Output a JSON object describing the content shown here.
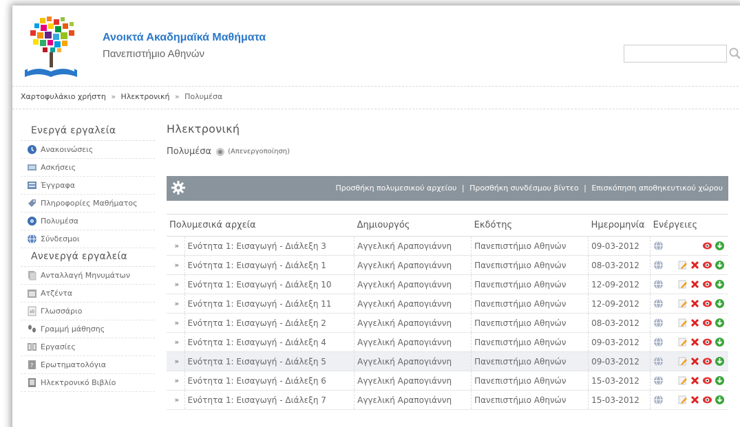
{
  "header": {
    "title": "Ανοικτά Ακαδημαϊκά Μαθήματα",
    "subtitle": "Πανεπιστήμιο Αθηνών",
    "search_value": ""
  },
  "breadcrumb": {
    "items": [
      "Χαρτοφυλάκιο χρήστη",
      "Ηλεκτρονική",
      "Πολυμέσα"
    ],
    "separator": "»"
  },
  "sidebar": {
    "active_heading": "Ενεργά εργαλεία",
    "active_items": [
      {
        "label": "Ανακοινώσεις",
        "icon": "announcements-icon"
      },
      {
        "label": "Ασκήσεις",
        "icon": "exercises-icon"
      },
      {
        "label": "Έγγραφα",
        "icon": "documents-icon"
      },
      {
        "label": "Πληροφορίες Μαθήματος",
        "icon": "course-info-icon"
      },
      {
        "label": "Πολυμέσα",
        "icon": "multimedia-icon"
      },
      {
        "label": "Σύνδεσμοι",
        "icon": "links-icon"
      }
    ],
    "inactive_heading": "Ανενεργά εργαλεία",
    "inactive_items": [
      {
        "label": "Ανταλλαγή Μηνυμάτων",
        "icon": "messages-icon"
      },
      {
        "label": "Ατζέντα",
        "icon": "agenda-icon"
      },
      {
        "label": "Γλωσσάριο",
        "icon": "glossary-icon"
      },
      {
        "label": "Γραμμή μάθησης",
        "icon": "learning-path-icon"
      },
      {
        "label": "Εργασίες",
        "icon": "assignments-icon"
      },
      {
        "label": "Ερωτηματολόγια",
        "icon": "questionnaires-icon"
      },
      {
        "label": "Ηλεκτρονικό Βιβλίο",
        "icon": "ebook-icon"
      }
    ]
  },
  "main": {
    "course_title": "Ηλεκτρονική",
    "tool_name": "Πολυμέσα",
    "toggle_label": "(Απενεργοποίηση)",
    "actions": {
      "add_media": "Προσθήκη πολυμεσικού αρχείου",
      "add_video_link": "Προσθήκη συνδέσμου βίντεο",
      "storage_overview": "Επισκόπηση αποθηκευτικού χώρου",
      "separator": "|"
    },
    "table": {
      "headers": [
        "Πολυμεσικά αρχεία",
        "Δημιουργός",
        "Εκδότης",
        "Ημερομηνία",
        "Ενέργειες"
      ],
      "rows": [
        {
          "file": "Ενότητα 1: Εισαγωγή - Διάλεξη 3",
          "creator": "Αγγελική Αραπογιάννη",
          "publisher": "Πανεπιστήμιο Αθηνών",
          "date": "09-03-2012",
          "full_actions": false
        },
        {
          "file": "Ενότητα 1: Εισαγωγή - Διάλεξη 1",
          "creator": "Αγγελική Αραπογιάννη",
          "publisher": "Πανεπιστήμιο Αθηνών",
          "date": "08-03-2012",
          "full_actions": true
        },
        {
          "file": "Ενότητα 1: Εισαγωγή - Διάλεξη 10",
          "creator": "Αγγελική Αραπογιάννη",
          "publisher": "Πανεπιστήμιο Αθηνών",
          "date": "12-09-2012",
          "full_actions": true
        },
        {
          "file": "Ενότητα 1: Εισαγωγή - Διάλεξη 11",
          "creator": "Αγγελική Αραπογιάννη",
          "publisher": "Πανεπιστήμιο Αθηνών",
          "date": "12-09-2012",
          "full_actions": true
        },
        {
          "file": "Ενότητα 1: Εισαγωγή - Διάλεξη 2",
          "creator": "Αγγελική Αραπογιάννη",
          "publisher": "Πανεπιστήμιο Αθηνών",
          "date": "08-03-2012",
          "full_actions": true
        },
        {
          "file": "Ενότητα 1: Εισαγωγή - Διάλεξη 4",
          "creator": "Αγγελική Αραπογιάννη",
          "publisher": "Πανεπιστήμιο Αθηνών",
          "date": "09-03-2012",
          "full_actions": true
        },
        {
          "file": "Ενότητα 1: Εισαγωγή - Διάλεξη 5",
          "creator": "Αγγελική Αραπογιάννη",
          "publisher": "Πανεπιστήμιο Αθηνών",
          "date": "09-03-2012",
          "full_actions": true
        },
        {
          "file": "Ενότητα 1: Εισαγωγή - Διάλεξη 6",
          "creator": "Αγγελική Αραπογιάννη",
          "publisher": "Πανεπιστήμιο Αθηνών",
          "date": "15-03-2012",
          "full_actions": true
        },
        {
          "file": "Ενότητα 1: Εισαγωγή - Διάλεξη 7",
          "creator": "Αγγελική Αραπογιάννη",
          "publisher": "Πανεπιστήμιο Αθηνών",
          "date": "15-03-2012",
          "full_actions": true
        }
      ],
      "highlighted_row": 6
    }
  },
  "colors": {
    "title_blue": "#2a78c9",
    "action_bar": "#8a949c",
    "delete_red": "#e02020",
    "download_green": "#3aa53a"
  }
}
